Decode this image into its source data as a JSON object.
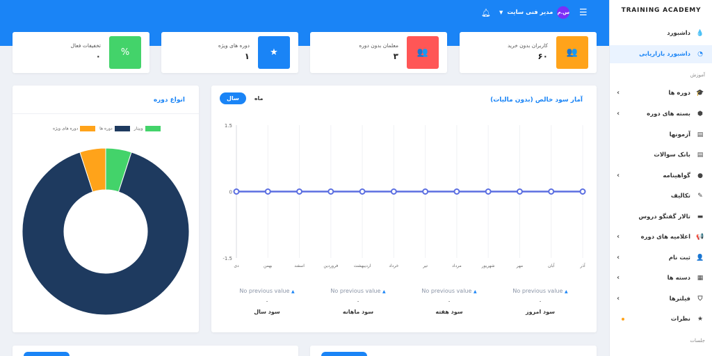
{
  "sidebar": {
    "brand": "TRAINING ACADEMY",
    "items": [
      {
        "label": "داشبورد",
        "icon": "drop-icon",
        "glyph": "💧",
        "chevron": false
      },
      {
        "label": "داشبورد بازاریابی",
        "icon": "pie-chart-icon",
        "glyph": "◔",
        "chevron": false,
        "active": true
      },
      {
        "label": "دوره ها",
        "icon": "graduation-cap-icon",
        "glyph": "🎓",
        "chevron": true
      },
      {
        "label": "بسته های دوره",
        "icon": "box-icon",
        "glyph": "⬢",
        "chevron": true
      },
      {
        "label": "آزمونها",
        "icon": "file-icon",
        "glyph": "▤",
        "chevron": false
      },
      {
        "label": "بانک سوالات",
        "icon": "file-icon",
        "glyph": "▤",
        "chevron": false
      },
      {
        "label": "گواهینامه",
        "icon": "certificate-icon",
        "glyph": "●",
        "chevron": true
      },
      {
        "label": "تکالیف",
        "icon": "pencil-icon",
        "glyph": "✎",
        "chevron": false
      },
      {
        "label": "تالار گفتگو دروس",
        "icon": "comment-icon",
        "glyph": "▬",
        "chevron": false
      },
      {
        "label": "اعلامیه های دوره",
        "icon": "megaphone-icon",
        "glyph": "📢",
        "chevron": true
      },
      {
        "label": "ثبت نام",
        "icon": "user-plus-icon",
        "glyph": "👤",
        "chevron": true
      },
      {
        "label": "دسته ها",
        "icon": "grid-icon",
        "glyph": "▦",
        "chevron": true
      },
      {
        "label": "فیلترها",
        "icon": "filter-icon",
        "glyph": "⛉",
        "chevron": true
      },
      {
        "label": "نظرات",
        "icon": "star-icon",
        "glyph": "★",
        "chevron": false,
        "dot": true
      }
    ],
    "section_education": "آموزش",
    "section_sessions": "جلسات"
  },
  "topbar": {
    "user_name": "مدیر فنی سایت",
    "avatar_initials": "س.م",
    "bell_icon": "bell-icon",
    "menu_icon": "hamburger-icon"
  },
  "stats": [
    {
      "label": "کاربران بدون خرید",
      "value": "۶۰",
      "color": "#ffa31a",
      "icon": "users-icon",
      "glyph": "👥"
    },
    {
      "label": "معلمان بدون دوره",
      "value": "۳",
      "color": "#ff5656",
      "icon": "users-icon",
      "glyph": "👥"
    },
    {
      "label": "دوره های ویژه",
      "value": "۱",
      "color": "#1a84f6",
      "icon": "star-icon",
      "glyph": "★"
    },
    {
      "label": "تخفیفات فعال",
      "value": "۰",
      "color": "#43d36a",
      "icon": "percent-icon",
      "glyph": "%"
    }
  ],
  "profit_card": {
    "title": "آمار سود خالص (بدون مالیات)",
    "toggle_year": "سال",
    "toggle_month": "ماه",
    "kpis": [
      {
        "prev": "No previous value",
        "value": "۰",
        "name": "سود امروز"
      },
      {
        "prev": "No previous value",
        "value": "۰",
        "name": "سود هفته"
      },
      {
        "prev": "No previous value",
        "value": "۰",
        "name": "سود ماهانه"
      },
      {
        "prev": "No previous value",
        "value": "۰",
        "name": "سود سال"
      }
    ]
  },
  "types_card": {
    "title": "انواع دوره",
    "legend": [
      "دوره ها",
      "دوره های ویژه",
      "وبینار"
    ]
  },
  "chart_data": [
    {
      "type": "line",
      "x": [
        "آذر",
        "آبان",
        "مهر",
        "شهریور",
        "مرداد",
        "تیر",
        "خرداد",
        "اردیبهشت",
        "فروردین",
        "اسفند",
        "بهمن",
        "دی"
      ],
      "series": [
        {
          "values": [
            0,
            0,
            0,
            0,
            0,
            0,
            0,
            0,
            0,
            0,
            0,
            0
          ],
          "color": "#5b6ee1"
        }
      ],
      "yticks": [
        "1.5",
        "0",
        "-1.5"
      ],
      "ylim": [
        -1.5,
        1.5
      ],
      "grid": true
    },
    {
      "type": "pie",
      "labels": [
        "دوره ها",
        "دوره های ویژه",
        "وبینار"
      ],
      "values": [
        90,
        5,
        5
      ],
      "colors": [
        "#1e3a5f",
        "#ffa31a",
        "#43d36a"
      ],
      "donut": true
    }
  ]
}
